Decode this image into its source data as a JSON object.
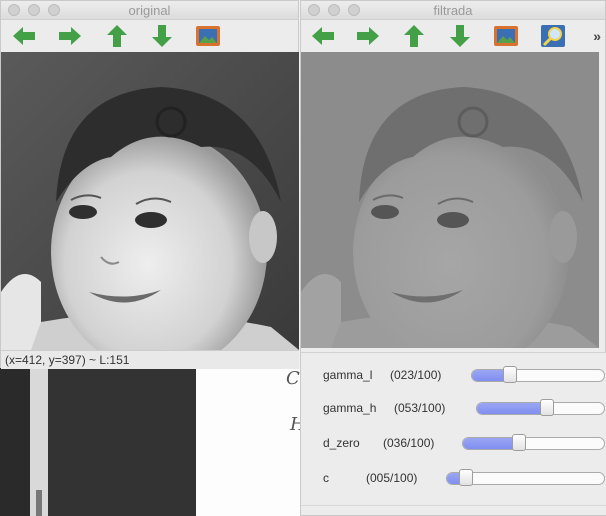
{
  "windows": {
    "original": {
      "title": "original",
      "status": "(x=412, y=397) ~ L:151"
    },
    "filtered": {
      "title": "filtrada"
    }
  },
  "toolbar": {
    "buttons": [
      "arrow-left-icon",
      "arrow-right-icon",
      "arrow-up-icon",
      "arrow-down-icon",
      "save-image-icon",
      "zoom-icon"
    ],
    "more_label": "»",
    "colors": {
      "arrow_green": "#43a047",
      "save_orange": "#d9722f",
      "save_blue": "#3a6fb3"
    }
  },
  "sliders": [
    {
      "name": "gamma_l",
      "value_label": "(023/100)",
      "value": 23,
      "max": 100
    },
    {
      "name": "gamma_h",
      "value_label": "(053/100)",
      "value": 53,
      "max": 100
    },
    {
      "name": "d_zero",
      "value_label": "(036/100)",
      "value": 36,
      "max": 100
    },
    {
      "name": "c",
      "value_label": "(005/100)",
      "value": 5,
      "max": 100
    }
  ],
  "colors": {
    "slider_fill": "#8593f2",
    "window_bg": "#ececec"
  }
}
